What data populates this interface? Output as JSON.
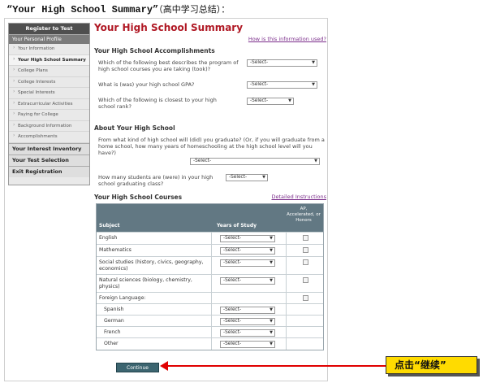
{
  "caption": {
    "title": "“Your High School Summary”",
    "subtitle": "（高中学习总结）："
  },
  "sidebar": {
    "register": "Register to Test",
    "personal": "Your Personal Profile",
    "items": [
      "Your Information",
      "Your High School Summary",
      "College Plans",
      "College Interests",
      "Special Interests",
      "Extracurricular Activities",
      "Paying for College",
      "Background Information",
      "Accomplishments"
    ],
    "interest": "Your Interest Inventory",
    "test_selection": "Your Test Selection",
    "exit": "Exit Registration"
  },
  "main": {
    "title": "Your High School Summary",
    "help_link": "How is this information used?",
    "accomplishments": {
      "heading": "Your High School Accomplishments",
      "q1": "Which of the following best describes the program of high school courses you are taking (took)?",
      "q2": "What is (was) your high school GPA?",
      "q3": "Which of the following is closest to your high school rank?",
      "select": "-Select-"
    },
    "about": {
      "heading": "About Your High School",
      "q1": "From what kind of high school will (did) you graduate? (Or, if you will graduate from a home school, how many years of homeschooling at the high school level will you have?)",
      "q2": "How many students are (were) in your high school graduating class?",
      "select": "-Select-"
    },
    "courses": {
      "heading": "Your High School Courses",
      "detail_link": "Detailed Instructions",
      "col_subject": "Subject",
      "col_years": "Years of Study",
      "col_ap": "AP, Accelerated, or Honors",
      "select": "-Select-",
      "rows": [
        "English",
        "Mathematics",
        "Social studies (history, civics, geography, economics)",
        "Natural sciences (biology, chemistry, physics)",
        "Foreign Language:",
        "Spanish",
        "German",
        "French",
        "Other"
      ]
    },
    "continue": "Continue"
  },
  "annotation": {
    "label": "点击“继续”",
    "accent": "#e00000",
    "box_color": "#ffdb00"
  }
}
